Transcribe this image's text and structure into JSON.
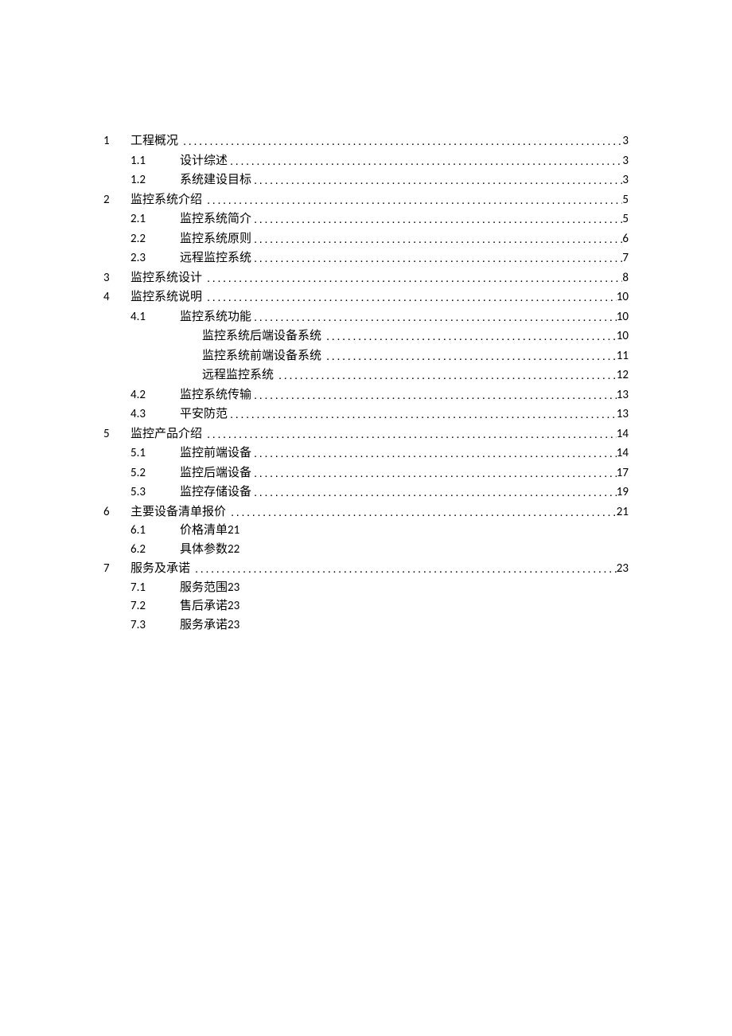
{
  "toc": [
    {
      "level": 1,
      "num": "1",
      "title": "工程概况",
      "page": "3",
      "leader": true
    },
    {
      "level": 2,
      "num": "1.1",
      "title": "设计综述",
      "page": "3",
      "leader": true
    },
    {
      "level": 2,
      "num": "1.2",
      "title": "系统建设目标",
      "page": "3",
      "leader": true
    },
    {
      "level": 1,
      "num": "2",
      "title": "监控系统介绍",
      "page": "5",
      "leader": true
    },
    {
      "level": 2,
      "num": "2.1",
      "title": "监控系统简介",
      "page": "5",
      "leader": true
    },
    {
      "level": 2,
      "num": "2.2",
      "title": "监控系统原则",
      "page": "6",
      "leader": true
    },
    {
      "level": 2,
      "num": "2.3",
      "title": "远程监控系统",
      "page": "7",
      "leader": true
    },
    {
      "level": 1,
      "num": "3",
      "title": "监控系统设计",
      "page": "8",
      "leader": true
    },
    {
      "level": 1,
      "num": "4",
      "title": "监控系统说明",
      "page": "10",
      "leader": true
    },
    {
      "level": 2,
      "num": "4.1",
      "title": "监控系统功能",
      "page": "10",
      "leader": true
    },
    {
      "level": 3,
      "num": "",
      "title": "监控系统后端设备系统",
      "page": "10",
      "leader": true
    },
    {
      "level": 3,
      "num": "",
      "title": "监控系统前端设备系统",
      "page": "11",
      "leader": true
    },
    {
      "level": 3,
      "num": "",
      "title": "远程监控系统",
      "page": "12",
      "leader": true
    },
    {
      "level": 2,
      "num": "4.2",
      "title": "监控系统传输",
      "page": "13",
      "leader": true
    },
    {
      "level": 2,
      "num": "4.3",
      "title": "平安防范",
      "page": "13",
      "leader": true
    },
    {
      "level": 1,
      "num": "5",
      "title": "监控产品介绍",
      "page": "14",
      "leader": true
    },
    {
      "level": 2,
      "num": "5.1",
      "title": "监控前端设备",
      "page": "14",
      "leader": true
    },
    {
      "level": 2,
      "num": "5.2",
      "title": "监控后端设备",
      "page": "17",
      "leader": true
    },
    {
      "level": 2,
      "num": "5.3",
      "title": "监控存储设备",
      "page": "19",
      "leader": true
    },
    {
      "level": 1,
      "num": "6",
      "title": "主要设备清单报价",
      "page": "21",
      "leader": true
    },
    {
      "level": 2,
      "num": "6.1",
      "title": "价格清单",
      "page": "21",
      "leader": false
    },
    {
      "level": 2,
      "num": "6.2",
      "title": "具体参数",
      "page": "22",
      "leader": false
    },
    {
      "level": 1,
      "num": "7",
      "title": "服务及承诺",
      "page": "23",
      "leader": true
    },
    {
      "level": 2,
      "num": "7.1",
      "title": "服务范围",
      "page": "23",
      "leader": false
    },
    {
      "level": 2,
      "num": "7.2",
      "title": "售后承诺",
      "page": "23",
      "leader": false
    },
    {
      "level": 2,
      "num": "7.3",
      "title": "服务承诺",
      "page": "23",
      "leader": false
    }
  ]
}
